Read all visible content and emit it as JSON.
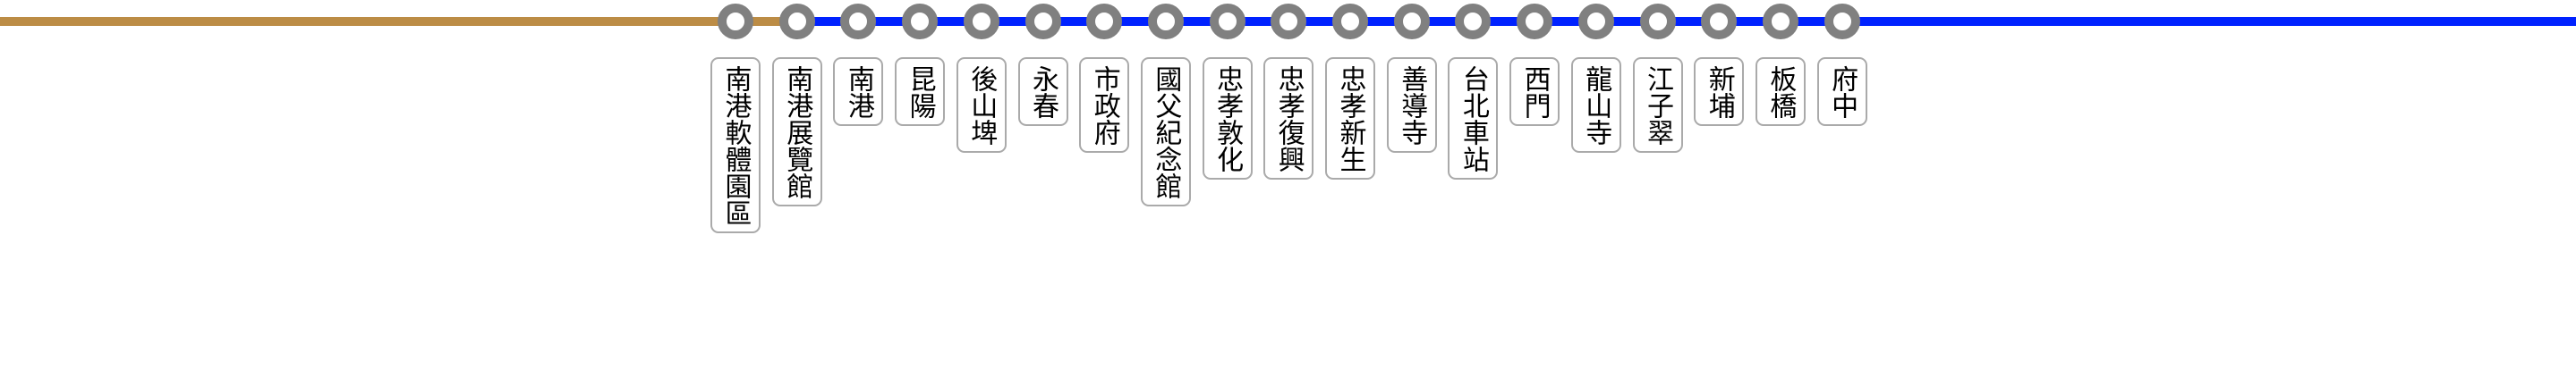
{
  "line": {
    "colors": {
      "brown_line": "#BC8C45",
      "blue_line": "#0022FF",
      "station_ring": "#808080",
      "label_border": "#AAAAAA"
    }
  },
  "stations": [
    {
      "name": "南港軟體園區",
      "line": "brown"
    },
    {
      "name": "南港展覽館",
      "line": "blue"
    },
    {
      "name": "南港",
      "line": "blue"
    },
    {
      "name": "昆陽",
      "line": "blue"
    },
    {
      "name": "後山埤",
      "line": "blue"
    },
    {
      "name": "永春",
      "line": "blue"
    },
    {
      "name": "市政府",
      "line": "blue"
    },
    {
      "name": "國父紀念館",
      "line": "blue"
    },
    {
      "name": "忠孝敦化",
      "line": "blue"
    },
    {
      "name": "忠孝復興",
      "line": "blue"
    },
    {
      "name": "忠孝新生",
      "line": "blue"
    },
    {
      "name": "善導寺",
      "line": "blue"
    },
    {
      "name": "台北車站",
      "line": "blue"
    },
    {
      "name": "西門",
      "line": "blue"
    },
    {
      "name": "龍山寺",
      "line": "blue"
    },
    {
      "name": "江子翠",
      "line": "blue"
    },
    {
      "name": "新埔",
      "line": "blue"
    },
    {
      "name": "板橋",
      "line": "blue"
    },
    {
      "name": "府中",
      "line": "blue"
    }
  ]
}
